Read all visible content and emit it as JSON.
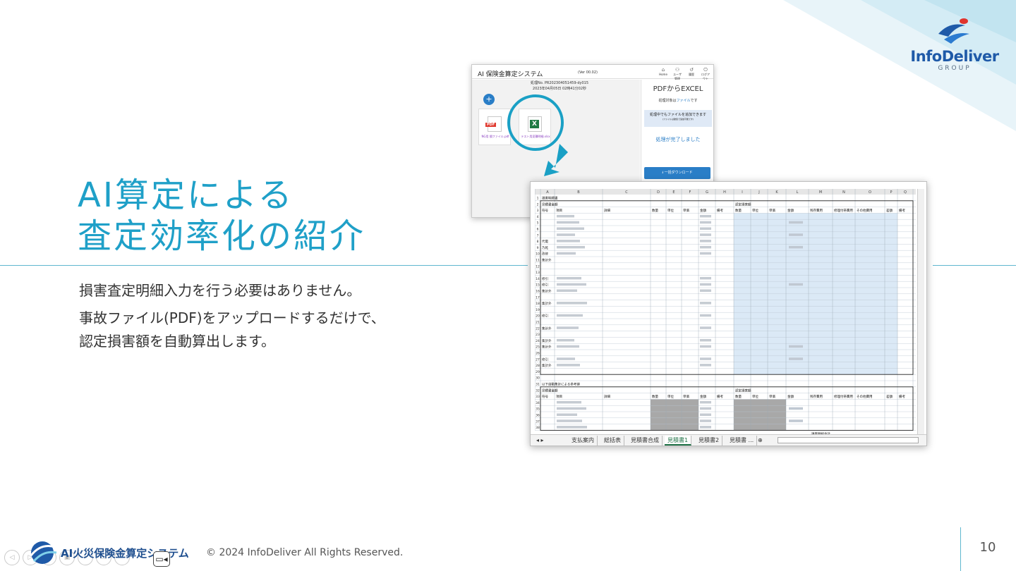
{
  "slide": {
    "title_line1": "AI算定による",
    "title_line2": "査定効率化の紹介",
    "desc_line1": "損害査定明細入力を行う必要はありません。",
    "desc_line2": "事故ファイル(PDF)をアップロードするだけで、",
    "desc_line3": "認定損害額を自動算出します。",
    "page_number": "10"
  },
  "logo": {
    "text": "InfoDeliver",
    "sub": "GROUP"
  },
  "footer": {
    "system_name": "AI火災保険金算定システム",
    "copyright": "© 2024 InfoDeliver All Rights Reserved."
  },
  "webapp": {
    "app_name": "AI 保険金算定システム",
    "version": "(Ver 00.02)",
    "nav": [
      "Home",
      "ユーザ管理",
      "履歴",
      "ログアウト"
    ],
    "proc_no": "処理No. PR202304051459-dy015",
    "proc_date": "2023年04月05日 02時41分02秒",
    "pdf_badge": "PDF",
    "pdf_name": "NG用 損ファイル.pdf",
    "xls_badge": "X",
    "xls_name": "テスト用見積明細.xlsx",
    "panel_title": "PDFからEXCEL",
    "panel_target_prefix": "処理対象は",
    "panel_target_link": "ファイル",
    "panel_target_suffix": "です",
    "panel_add": "処理中でもファイルを追加できます",
    "panel_add_small": "(ファイルは破棄で追加可能です)",
    "panel_done": "処理が完了しました",
    "download_label": "一括ダウンロード"
  },
  "excel": {
    "columns": [
      "A",
      "B",
      "C",
      "D",
      "E",
      "F",
      "G",
      "H",
      "I",
      "J",
      "K",
      "L",
      "M",
      "N",
      "O",
      "P",
      "Q"
    ],
    "row1_label": "損害明細書",
    "est_label": "見積書金額",
    "cert_label": "認定損害額",
    "headers_left": [
      "符号",
      "項目",
      "詳細",
      "数量",
      "単位",
      "単価",
      "金額",
      "備考"
    ],
    "headers_right": [
      "数量",
      "単位",
      "単価",
      "金額",
      "残存費用",
      "修理付帯費用",
      "その他費用",
      "差額",
      "備考"
    ],
    "section2_label": "以下自動集計による参考値",
    "total_label": "損害額総合計",
    "row_labels": [
      "1",
      "2",
      "3",
      "4",
      "5",
      "6",
      "7",
      "8",
      "9",
      "10",
      "11",
      "12",
      "13",
      "14",
      "15",
      "16",
      "17",
      "18",
      "19",
      "20",
      "21",
      "22",
      "23",
      "24",
      "25",
      "26",
      "27",
      "28",
      "29",
      "30",
      "31",
      "32",
      "33",
      "34",
      "35",
      "36",
      "37",
      "38"
    ],
    "symbols": {
      "8": "代電",
      "9": "乃乾",
      "10": "改修",
      "11": "集計外",
      "14": "修引",
      "15": "修引",
      "16": "集計外",
      "18": "集計外",
      "20": "修引",
      "22": "集計外",
      "24": "集計外",
      "25": "集計外",
      "27": "修引",
      "28": "集計外"
    },
    "tabs": [
      "支払案内",
      "総括表",
      "見積書合成",
      "見積書1",
      "見積書2",
      "見積書 ..."
    ],
    "active_tab": 3
  }
}
